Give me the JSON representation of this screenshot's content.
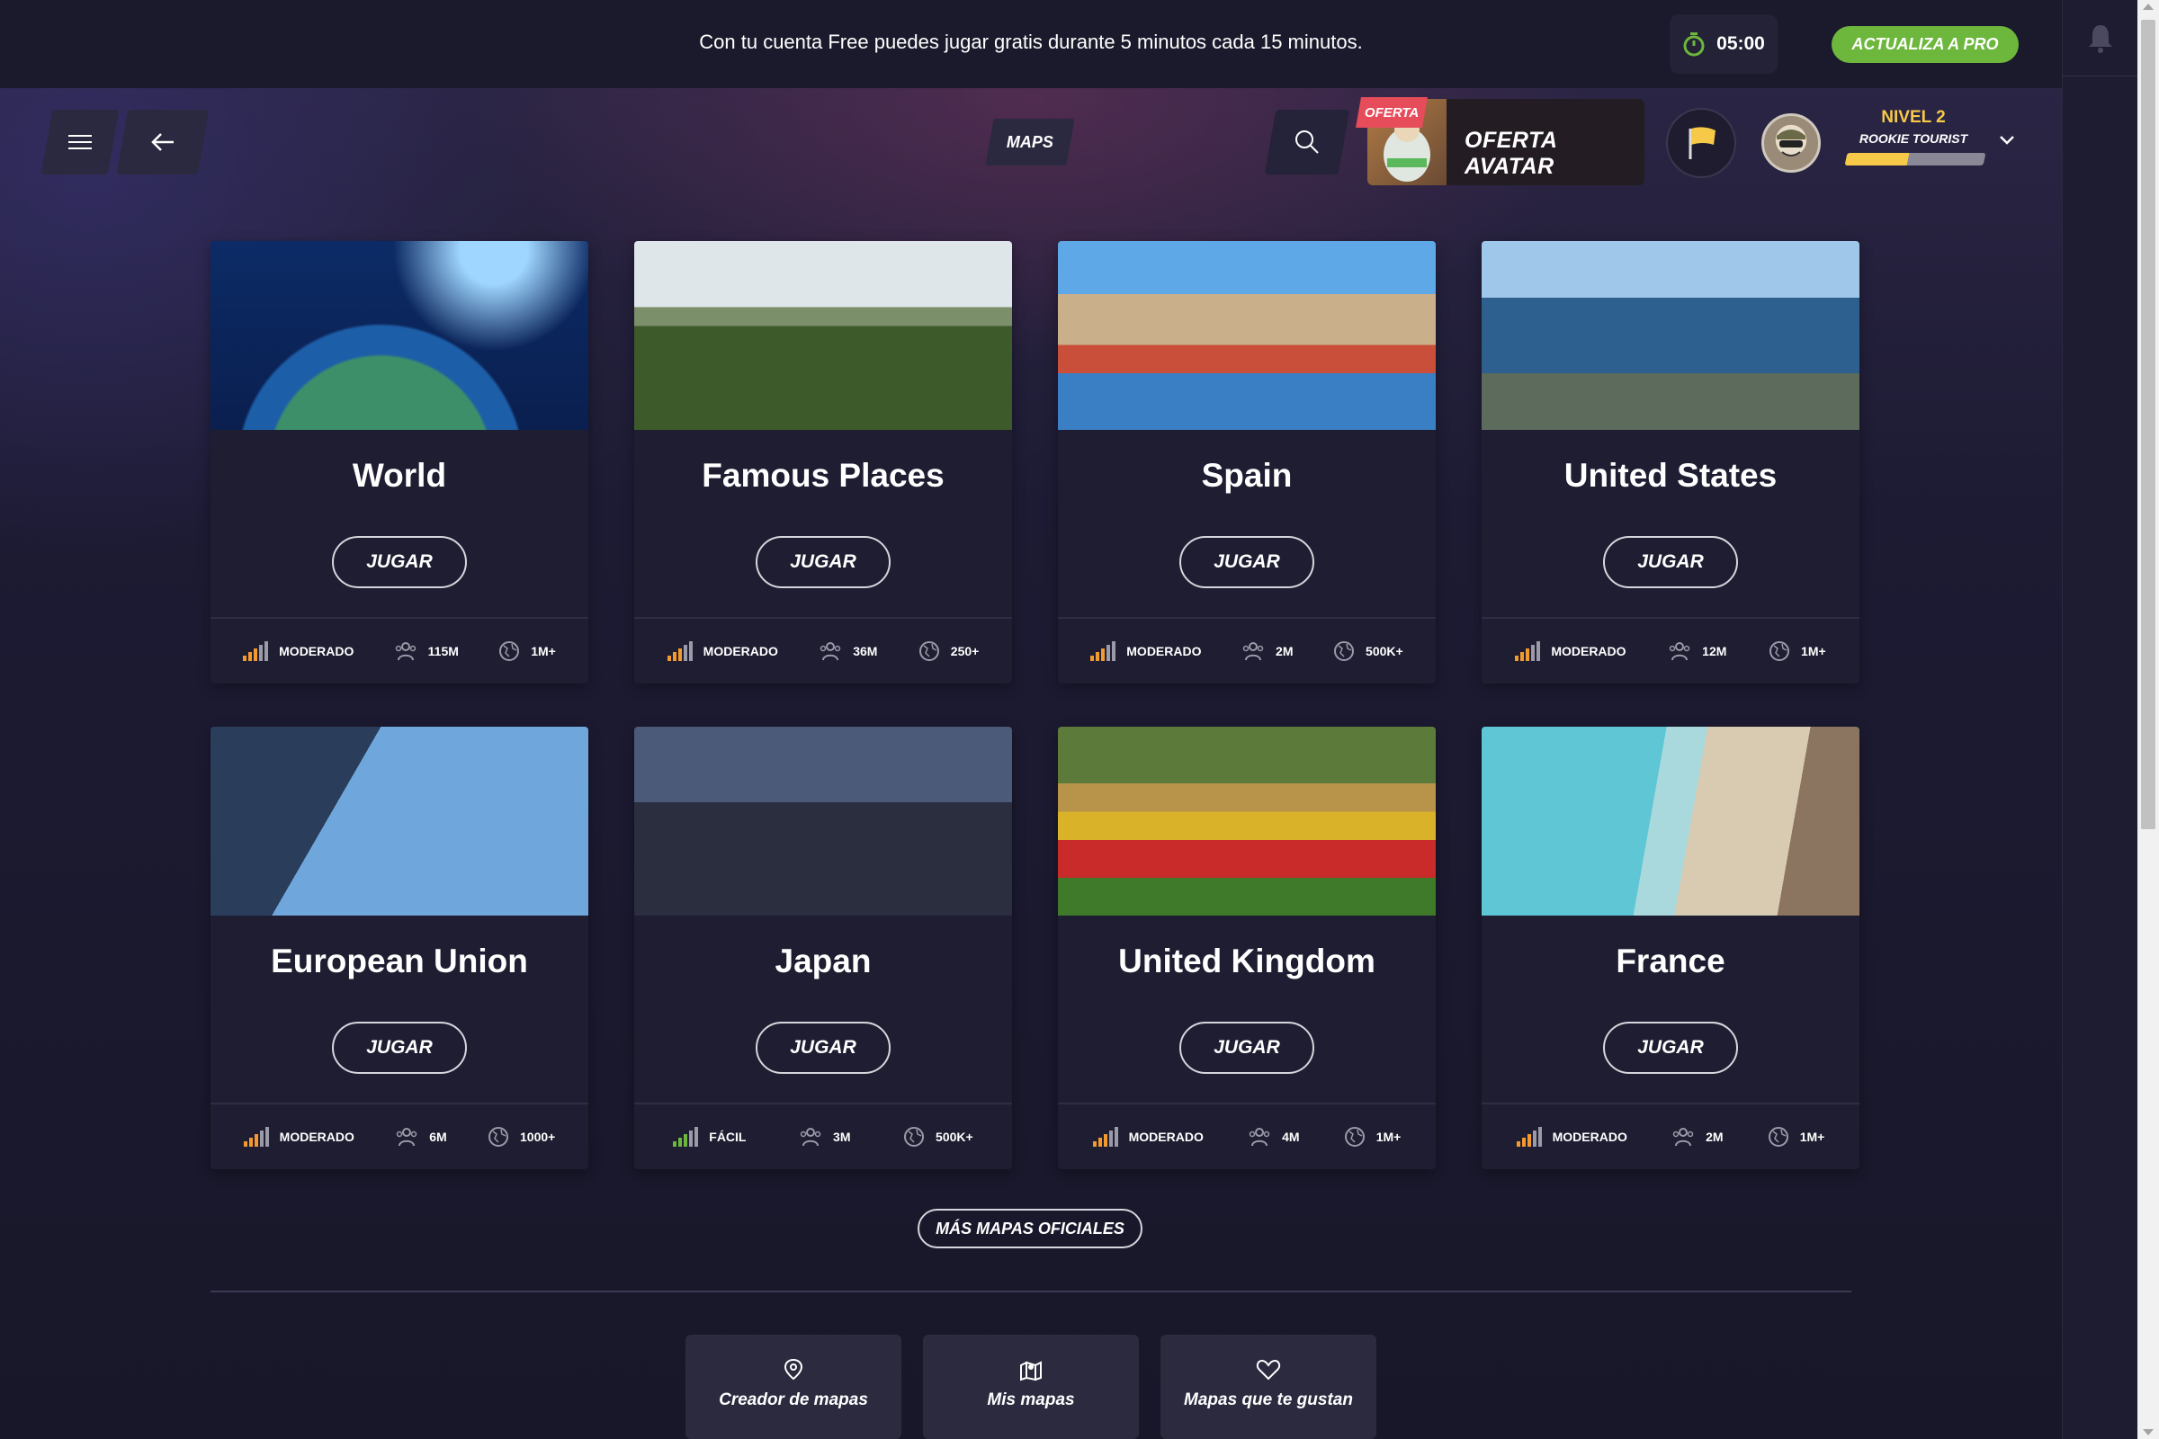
{
  "banner": {
    "text": "Con tu cuenta Free puedes jugar gratis durante 5 minutos cada 15 minutos.",
    "timer": "05:00",
    "pro_button": "ACTUALIZA A PRO"
  },
  "nav": {
    "maps_tab": "MAPS",
    "offer_tag": "OFERTA",
    "offer_label": "OFERTA AVATAR",
    "level": "NIVEL 2",
    "rank": "ROOKIE TOURIST",
    "level_progress": 0.45
  },
  "cards": [
    {
      "title": "World",
      "play": "JUGAR",
      "difficulty": "MODERADO",
      "players": "115M",
      "locations": "1M+"
    },
    {
      "title": "Famous Places",
      "play": "JUGAR",
      "difficulty": "MODERADO",
      "players": "36M",
      "locations": "250+"
    },
    {
      "title": "Spain",
      "play": "JUGAR",
      "difficulty": "MODERADO",
      "players": "2M",
      "locations": "500K+"
    },
    {
      "title": "United States",
      "play": "JUGAR",
      "difficulty": "MODERADO",
      "players": "12M",
      "locations": "1M+"
    },
    {
      "title": "European Union",
      "play": "JUGAR",
      "difficulty": "MODERADO",
      "players": "6M",
      "locations": "1000+"
    },
    {
      "title": "Japan",
      "play": "JUGAR",
      "difficulty": "FÁCIL",
      "players": "3M",
      "locations": "500K+"
    },
    {
      "title": "United Kingdom",
      "play": "JUGAR",
      "difficulty": "MODERADO",
      "players": "4M",
      "locations": "1M+"
    },
    {
      "title": "France",
      "play": "JUGAR",
      "difficulty": "MODERADO",
      "players": "2M",
      "locations": "1M+"
    }
  ],
  "more_button": "MÁS MAPAS OFICIALES",
  "tiles": [
    {
      "label": "Creador de mapas",
      "icon": "map-pin-icon"
    },
    {
      "label": "Mis mapas",
      "icon": "map-icon"
    },
    {
      "label": "Mapas que te gustan",
      "icon": "heart-icon"
    }
  ],
  "colors": {
    "accent_green": "#6cb73c",
    "level_yellow": "#f7c948",
    "offer_red": "#e64c5a",
    "moderate": "#f29a2e",
    "easy": "#6cb73c"
  }
}
